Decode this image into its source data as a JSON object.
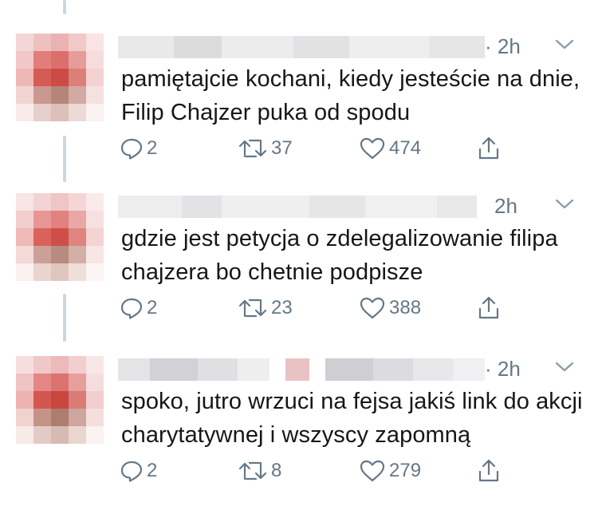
{
  "tweets": [
    {
      "time": "· 2h",
      "text": "pamiętajcie kochani, kiedy jesteście na dnie, Filip Chajzer puka od spodu",
      "replies": "2",
      "retweets": "37",
      "likes": "474"
    },
    {
      "time": "2h",
      "text": "gdzie jest petycja o zdelegalizowanie filipa chajzera bo chetnie podpisze",
      "replies": "2",
      "retweets": "23",
      "likes": "388"
    },
    {
      "time": "· 2h",
      "text": "spoko, jutro wrzuci na fejsa jakiś link do akcji charytatywnej i wszyscy zapomną",
      "replies": "2",
      "retweets": "8",
      "likes": "279"
    }
  ],
  "icons": {
    "reply": "reply-icon",
    "retweet": "retweet-icon",
    "like": "heart-icon",
    "share": "share-icon",
    "menu": "chevron-down-icon"
  },
  "colors": {
    "text": "#14171a",
    "secondary": "#657786",
    "thread_line": "#ccd6dd"
  }
}
